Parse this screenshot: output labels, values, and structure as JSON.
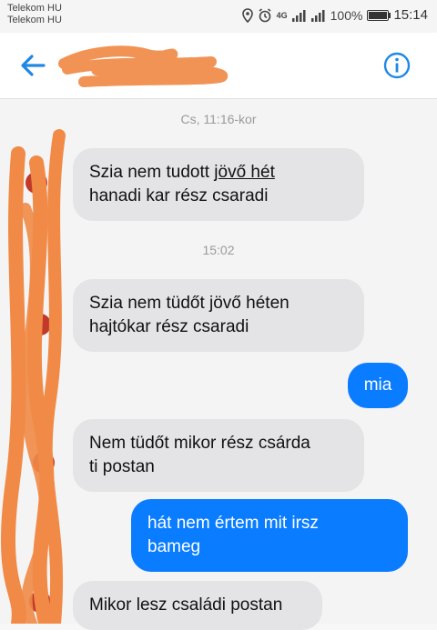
{
  "status_bar": {
    "carrier_1": "Telekom HU",
    "carrier_2": "Telekom HU",
    "network": "4G",
    "battery": "100%",
    "time": "15:14"
  },
  "header": {
    "back_icon": "arrow-left",
    "info_icon": "info-circle",
    "accent_color": "#1e88e5"
  },
  "chat": {
    "timestamps": [
      "Cs, 11:16-kor",
      "15:02"
    ],
    "messages": [
      {
        "direction": "in",
        "line1_a": "Szia nem tudott ",
        "line1_u": "jövő hét",
        "line2": "hanadi kar rész csaradi"
      },
      {
        "direction": "in",
        "line1": "Szia nem tüdőt jövő héten",
        "line2": "hajtókar rész csaradi"
      },
      {
        "direction": "out",
        "text": "mia"
      },
      {
        "direction": "in",
        "line1": "Nem tüdőt mikor rész csárda",
        "line2": "ti postan"
      },
      {
        "direction": "out",
        "line1": "hát nem értem mit irsz",
        "line2": "bameg"
      },
      {
        "direction": "in",
        "text": "Mikor lesz családi postan"
      }
    ],
    "incoming_color": "#e4e4e7",
    "outgoing_color": "#0a7cff"
  }
}
